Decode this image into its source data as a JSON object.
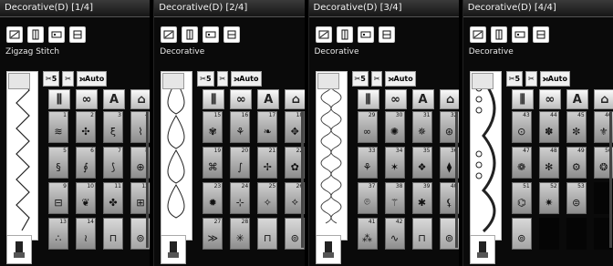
{
  "panels": [
    {
      "title": "Decorative(D) [1/4]",
      "stitch_name": "Zigzag Stitch",
      "options": {
        "length_label": "5",
        "mode_label": "Auto"
      },
      "letter_button": "A",
      "cells": [
        {
          "num": "1",
          "glyph": "≋"
        },
        {
          "num": "2",
          "glyph": "✣"
        },
        {
          "num": "3",
          "glyph": "ξ"
        },
        {
          "num": "4",
          "glyph": "⌇"
        },
        {
          "num": "5",
          "glyph": "§"
        },
        {
          "num": "6",
          "glyph": "∮"
        },
        {
          "num": "7",
          "glyph": "⟆"
        },
        {
          "num": "8",
          "glyph": "⊕"
        },
        {
          "num": "9",
          "glyph": "⊟"
        },
        {
          "num": "10",
          "glyph": "❦"
        },
        {
          "num": "11",
          "glyph": "✤"
        },
        {
          "num": "12",
          "glyph": "⊞"
        },
        {
          "num": "13",
          "glyph": "∴"
        },
        {
          "num": "14",
          "glyph": "≀"
        },
        {
          "num": "",
          "glyph": "⊓"
        },
        {
          "num": "",
          "glyph": "⊚"
        }
      ]
    },
    {
      "title": "Decorative(D) [2/4]",
      "stitch_name": "Decorative",
      "options": {
        "length_label": "5",
        "mode_label": "Auto"
      },
      "letter_button": "A",
      "cells": [
        {
          "num": "15",
          "glyph": "✾"
        },
        {
          "num": "16",
          "glyph": "⚘"
        },
        {
          "num": "17",
          "glyph": "❧"
        },
        {
          "num": "18",
          "glyph": "✥"
        },
        {
          "num": "19",
          "glyph": "⌘"
        },
        {
          "num": "20",
          "glyph": "∫"
        },
        {
          "num": "21",
          "glyph": "✢"
        },
        {
          "num": "22",
          "glyph": "✿"
        },
        {
          "num": "23",
          "glyph": "✹"
        },
        {
          "num": "24",
          "glyph": "⊹"
        },
        {
          "num": "25",
          "glyph": "✧"
        },
        {
          "num": "26",
          "glyph": "⟡"
        },
        {
          "num": "27",
          "glyph": "≫"
        },
        {
          "num": "28",
          "glyph": "✳"
        },
        {
          "num": "",
          "glyph": "⊓"
        },
        {
          "num": "",
          "glyph": "⊚"
        }
      ]
    },
    {
      "title": "Decorative(D) [3/4]",
      "stitch_name": "Decorative",
      "options": {
        "length_label": "5",
        "mode_label": "Auto"
      },
      "letter_button": "A",
      "cells": [
        {
          "num": "29",
          "glyph": "∞"
        },
        {
          "num": "30",
          "glyph": "✺"
        },
        {
          "num": "31",
          "glyph": "✵"
        },
        {
          "num": "32",
          "glyph": "⊛"
        },
        {
          "num": "33",
          "glyph": "⚘"
        },
        {
          "num": "34",
          "glyph": "✶"
        },
        {
          "num": "35",
          "glyph": "❖"
        },
        {
          "num": "36",
          "glyph": "⧫"
        },
        {
          "num": "37",
          "glyph": "⌾"
        },
        {
          "num": "38",
          "glyph": "⚚"
        },
        {
          "num": "39",
          "glyph": "✱"
        },
        {
          "num": "40",
          "glyph": "⚸"
        },
        {
          "num": "41",
          "glyph": "⁂"
        },
        {
          "num": "42",
          "glyph": "∿"
        },
        {
          "num": "",
          "glyph": "⊓"
        },
        {
          "num": "",
          "glyph": "⊚"
        }
      ]
    },
    {
      "title": "Decorative(D) [4/4]",
      "stitch_name": "Decorative",
      "options": {
        "length_label": "5",
        "mode_label": "Auto"
      },
      "letter_button": "A",
      "cells": [
        {
          "num": "43",
          "glyph": "⊙"
        },
        {
          "num": "44",
          "glyph": "✽"
        },
        {
          "num": "45",
          "glyph": "✼"
        },
        {
          "num": "46",
          "glyph": "⚜"
        },
        {
          "num": "47",
          "glyph": "❁"
        },
        {
          "num": "48",
          "glyph": "✻"
        },
        {
          "num": "49",
          "glyph": "⚙"
        },
        {
          "num": "50",
          "glyph": "❂"
        },
        {
          "num": "51",
          "glyph": "⌬"
        },
        {
          "num": "52",
          "glyph": "✷"
        },
        {
          "num": "53",
          "glyph": "⊜"
        },
        {
          "num": "",
          "glyph": ""
        },
        {
          "num": "",
          "glyph": "⊚"
        },
        {
          "num": "",
          "glyph": ""
        },
        {
          "num": "",
          "glyph": ""
        },
        {
          "num": "",
          "glyph": ""
        }
      ]
    }
  ]
}
